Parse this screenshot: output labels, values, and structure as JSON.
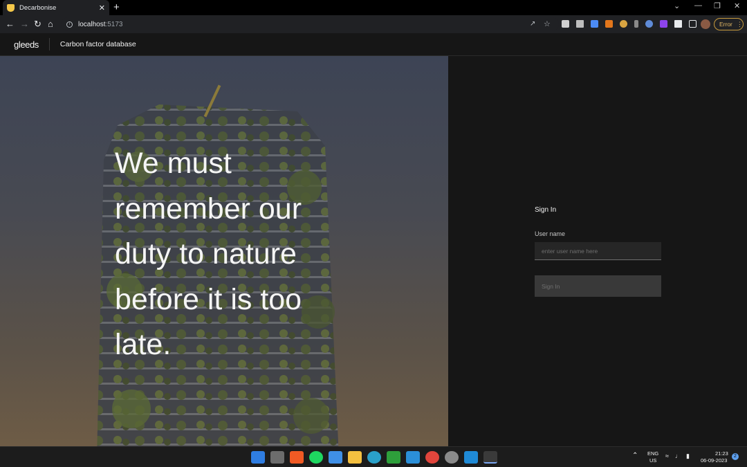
{
  "browser": {
    "tab_title": "Decarbonise",
    "tab_close": "✕",
    "new_tab": "+",
    "url_host": "localhost",
    "url_port": ":5173",
    "profile_status": "Error",
    "window_controls": [
      "⌄",
      "—",
      "❐",
      "✕"
    ]
  },
  "header": {
    "logo": "gleeds",
    "title": "Carbon factor database"
  },
  "hero": {
    "quote": "We must remember our duty to nature before it is too late."
  },
  "signin": {
    "title": "Sign In",
    "username_label": "User name",
    "username_placeholder": "enter user name here",
    "username_value": "",
    "button_label": "Sign In"
  },
  "taskbar": {
    "language_line1": "ENG",
    "language_line2": "US",
    "time": "21:23",
    "date": "06-09-2023",
    "notification_count": "2"
  },
  "colors": {
    "panel_bg": "#161616",
    "input_bg": "#262626",
    "button_bg": "#393939",
    "error_accent": "#e2b864"
  }
}
